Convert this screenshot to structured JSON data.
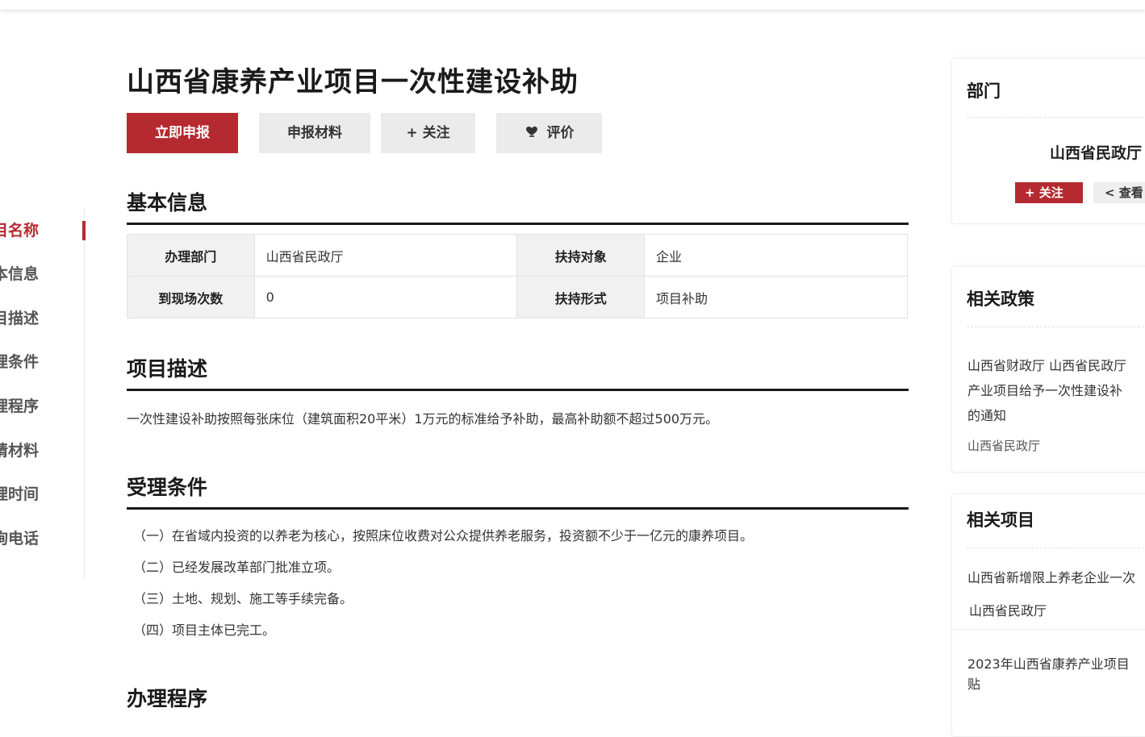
{
  "nav": {
    "items": [
      "项目名称",
      "基本信息",
      "项目描述",
      "受理条件",
      "办理程序",
      "申请材料",
      "办理时间",
      "咨询电话"
    ]
  },
  "page": {
    "title": "山西省康养产业项目一次性建设补助"
  },
  "actions": {
    "apply": "立即申报",
    "materials": "申报材料",
    "follow": "+ 关注",
    "review": "评价",
    "review_icon": "heart-hand-icon"
  },
  "basic_info": {
    "heading": "基本信息",
    "dept_label": "办理部门",
    "dept_value": "山西省民政厅",
    "target_label": "扶持对象",
    "target_value": "企业",
    "visits_label": "到现场次数",
    "visits_value": "0",
    "form_label": "扶持形式",
    "form_value": "项目补助"
  },
  "description": {
    "heading": "项目描述",
    "text": "一次性建设补助按照每张床位（建筑面积20平米）1万元的标准给予补助，最高补助额不超过500万元。"
  },
  "conditions": {
    "heading": "受理条件",
    "items": [
      "（一）在省域内投资的以养老为核心，按照床位收费对公众提供养老服务，投资额不少于一亿元的康养项目。",
      "（二）已经发展改革部门批准立项。",
      "（三）土地、规划、施工等手续完备。",
      "（四）项目主体已完工。"
    ]
  },
  "procedure": {
    "heading": "办理程序"
  },
  "sidebar": {
    "dept": {
      "heading": "部门",
      "name": "山西省民政厅",
      "follow": "+ 关注",
      "view": "< 查看"
    },
    "policies": {
      "heading": "相关政策",
      "line1": "山西省财政厅 山西省民政厅",
      "line2": "产业项目给予一次性建设补",
      "line3": "的通知",
      "source": "山西省民政厅"
    },
    "projects": {
      "heading": "相关项目",
      "item1_title": "山西省新增限上养老企业一次",
      "item1_source": "山西省民政厅",
      "item2_line1": "2023年山西省康养产业项目",
      "item2_line2": "贴"
    }
  },
  "colors": {
    "accent": "#b52a30",
    "button_gray": "#ebebeb",
    "table_header_bg": "#f1f1f1"
  }
}
